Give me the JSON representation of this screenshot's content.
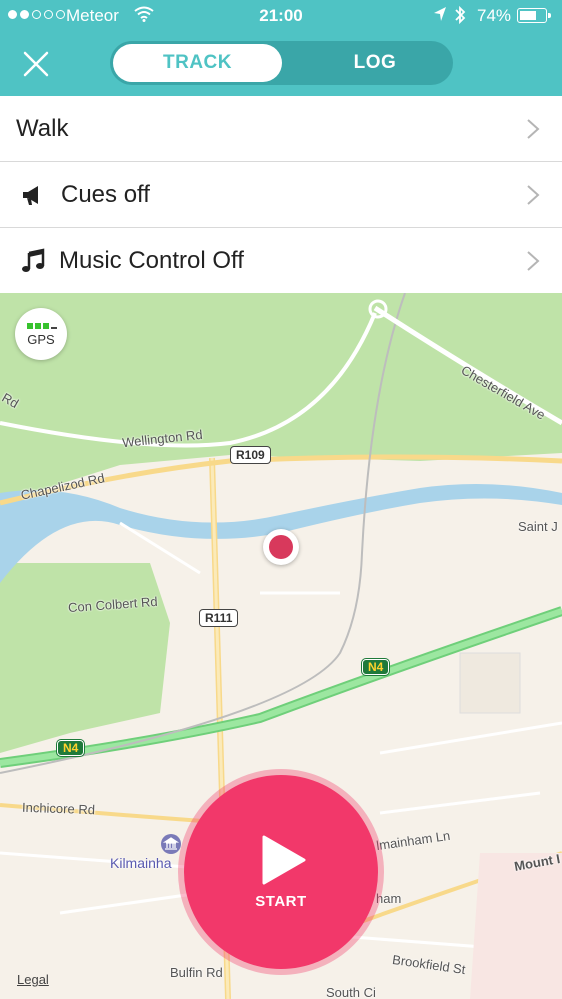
{
  "status_bar": {
    "carrier": "Meteor",
    "time": "21:00",
    "battery": "74%",
    "battery_level": 0.74,
    "signal_dots_filled": 2,
    "signal_dots_total": 5
  },
  "header": {
    "close_icon": "close-icon",
    "tabs": [
      {
        "label": "TRACK",
        "selected": true
      },
      {
        "label": "LOG",
        "selected": false
      }
    ]
  },
  "settings": {
    "rows": [
      {
        "label": "Walk",
        "icon": null
      },
      {
        "label": "Cues off",
        "icon": "megaphone-icon"
      },
      {
        "label": "Music Control Off",
        "icon": "music-note-icon"
      }
    ]
  },
  "map": {
    "gps_label": "GPS",
    "labels": {
      "chesterfield": "Chesterfield Ave",
      "wellington": "Wellington Rd",
      "chapelizod": "Chapelizod Rd",
      "con_colbert": "Con Colbert Rd",
      "saint_j": "Saint J",
      "inchicore": "Inchicore Rd",
      "kilmainham_ln": "lmainham Ln",
      "kilmainham": "Kilmainha",
      "mount": "Mount I",
      "ham": "ham",
      "brookfield": "Brookfield St",
      "bulfin": "Bulfin Rd",
      "south_ci": "South Ci",
      "rd_left": "Rd"
    },
    "shields": {
      "r109": "R109",
      "r111": "R111",
      "n4_a": "N4",
      "n4_b": "N4"
    },
    "legal": "Legal"
  },
  "start_button": {
    "label": "START"
  },
  "colors": {
    "accent": "#4fc3c4",
    "start": "#f2386a",
    "pin": "#d8395c",
    "park": "#bfe3a8",
    "water": "#a9d3ea",
    "motorway": "#86e08b"
  }
}
